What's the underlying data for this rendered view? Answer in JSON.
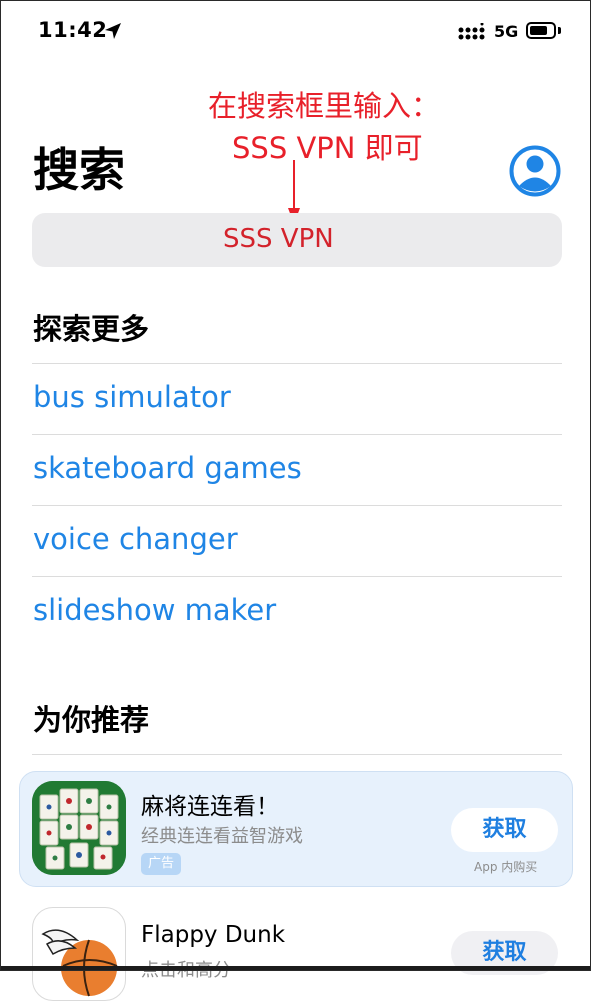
{
  "status_bar": {
    "time": "11:42",
    "network": "5G"
  },
  "header": {
    "title": "搜索"
  },
  "annotation": {
    "line1": "在搜索框里输入：",
    "line2": "SSS VPN  即可"
  },
  "search": {
    "value": "SSS VPN"
  },
  "discover": {
    "title": "探索更多",
    "items": [
      {
        "label": "bus simulator"
      },
      {
        "label": "skateboard games"
      },
      {
        "label": "voice changer"
      },
      {
        "label": "slideshow maker"
      }
    ]
  },
  "recommended": {
    "title": "为你推荐",
    "apps": [
      {
        "name": "麻将连连看！",
        "subtitle": "经典连连看益智游戏",
        "badge": "广告",
        "button": "获取",
        "note": "App 内购买"
      },
      {
        "name": "Flappy Dunk",
        "subtitle": "点击和高分",
        "button": "获取"
      }
    ]
  },
  "colors": {
    "accent": "#1f85e5",
    "annotation": "#e8202a",
    "ad_card": "#e7f1fc"
  },
  "icons": [
    "location-arrow-icon",
    "cellular-signal-icon",
    "battery-icon",
    "profile-icon",
    "mahjong-app-icon",
    "flappy-dunk-app-icon"
  ]
}
